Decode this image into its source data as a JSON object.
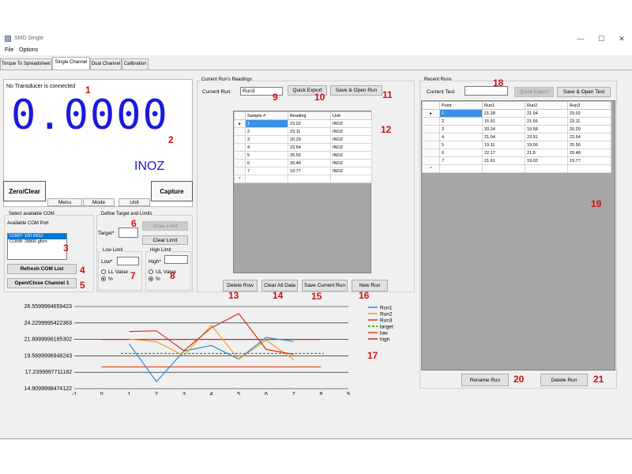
{
  "window": {
    "title": "SMD Single",
    "minimize": "—",
    "maximize": "☐",
    "close": "✕"
  },
  "menu": [
    "File",
    "Options"
  ],
  "tabs": [
    "Torque To Spreadsheet",
    "Single Channel",
    "Dual Channel",
    "Calibration"
  ],
  "display": {
    "status": "No Transducer is connected",
    "reading": "0.0000",
    "unit": "INOZ",
    "zero_clear": "Zero/Clear",
    "capture": "Capture",
    "menu_btn": "Menu",
    "mode_btn": "Mode",
    "unit_btn": "Unit"
  },
  "com": {
    "group": "Select available COM",
    "label": "Available COM Port",
    "ports": [
      "COM7: 160 INOZ",
      "COM8: 28800 gfcm"
    ],
    "refresh": "Refresh COM List",
    "open_close": "Open/Close Channel 1"
  },
  "target": {
    "group": "Define Target and Limits",
    "target_label": "Target*",
    "draw_limit": "Draw Limit",
    "clear_limit": "Clear Limit",
    "low_group": "Low Limit",
    "low_label": "Low*",
    "ll_value": "LL Value",
    "low_pct": "%",
    "high_group": "High Limit",
    "high_label": "High*",
    "ul_value": "UL Value",
    "high_pct": "%"
  },
  "current": {
    "group": "Current Run's Readings",
    "run_label": "Current Run:",
    "run_value": "Run3",
    "quick_export": "Quick Export",
    "save_open": "Save & Open Run",
    "headers": [
      "Sample #",
      "Reading",
      "Unit"
    ],
    "rows": [
      [
        "1",
        "23.02",
        "INOZ"
      ],
      [
        "2",
        "23.11",
        "INOZ"
      ],
      [
        "3",
        "20.29",
        "INOZ"
      ],
      [
        "4",
        "23.54",
        "INOZ"
      ],
      [
        "5",
        "25.56",
        "INOZ"
      ],
      [
        "6",
        "20.48",
        "INOZ"
      ],
      [
        "7",
        "19.77",
        "INOZ"
      ]
    ],
    "delete_row": "Delete Row",
    "clear_all": "Clear All Data",
    "save_current": "Save Current Run",
    "new_run": "New Run"
  },
  "recent": {
    "group": "Recent Runs",
    "test_label": "Current Test",
    "quick_export": "Quick Export",
    "save_open": "Save & Open Test",
    "headers": [
      "Point",
      "Run1",
      "Run2",
      "Run3"
    ],
    "rows": [
      [
        "1",
        "21.28",
        "21.94",
        "23.02"
      ],
      [
        "2",
        "15.91",
        "21.56",
        "23.11"
      ],
      [
        "3",
        "20.24",
        "19.58",
        "20.29"
      ],
      [
        "4",
        "21.04",
        "23.91",
        "23.54"
      ],
      [
        "5",
        "19.11",
        "19.06",
        "25.56"
      ],
      [
        "6",
        "22.17",
        "21.8",
        "20.48"
      ],
      [
        "7",
        "21.61",
        "19.02",
        "19.77"
      ]
    ],
    "rename": "Rename Run",
    "delete": "Delete Run"
  },
  "callouts": [
    "1",
    "2",
    "3",
    "4",
    "5",
    "6",
    "7",
    "8",
    "9",
    "10",
    "11",
    "12",
    "13",
    "14",
    "15",
    "16",
    "17",
    "18",
    "19",
    "20",
    "21"
  ],
  "colors": {
    "reading": "#1a1adc",
    "callout": "#d01010",
    "run1": "#2b8fd8",
    "run2": "#f0a020",
    "run3": "#d03818",
    "target": "#1a9a1a",
    "low": "#e04010",
    "high": "#c82828"
  },
  "chart_data": {
    "type": "line",
    "x": [
      1,
      2,
      3,
      4,
      5,
      6,
      7
    ],
    "xlim": [
      -1,
      9
    ],
    "xticks": [
      "-1",
      "0",
      "1",
      "2",
      "3",
      "4",
      "5",
      "6",
      "7",
      "8",
      "9"
    ],
    "ylim": [
      14.9099998474122,
      26.5599994659423
    ],
    "yticks": [
      "26.5599994659423",
      "24.2299995422363",
      "21.8999996185302",
      "19.5699996948243",
      "17.2399997711182",
      "14.9099998474122"
    ],
    "series": [
      {
        "name": "Run1",
        "values": [
          21.28,
          15.91,
          20.24,
          21.04,
          19.11,
          22.17,
          21.61
        ]
      },
      {
        "name": "Run2",
        "values": [
          21.94,
          21.56,
          19.58,
          23.91,
          19.06,
          21.8,
          19.02
        ]
      },
      {
        "name": "Run3",
        "values": [
          23.02,
          23.11,
          20.29,
          23.54,
          25.56,
          20.48,
          19.77
        ]
      }
    ],
    "lines": [
      {
        "name": "target",
        "value": 19.9,
        "xrange": [
          0.7,
          8.1
        ]
      },
      {
        "name": "low",
        "value": 18.0,
        "xrange": [
          0,
          8
        ]
      },
      {
        "name": "high",
        "value": 21.9,
        "xrange": [
          0,
          8
        ]
      }
    ],
    "legend_position": "right"
  }
}
